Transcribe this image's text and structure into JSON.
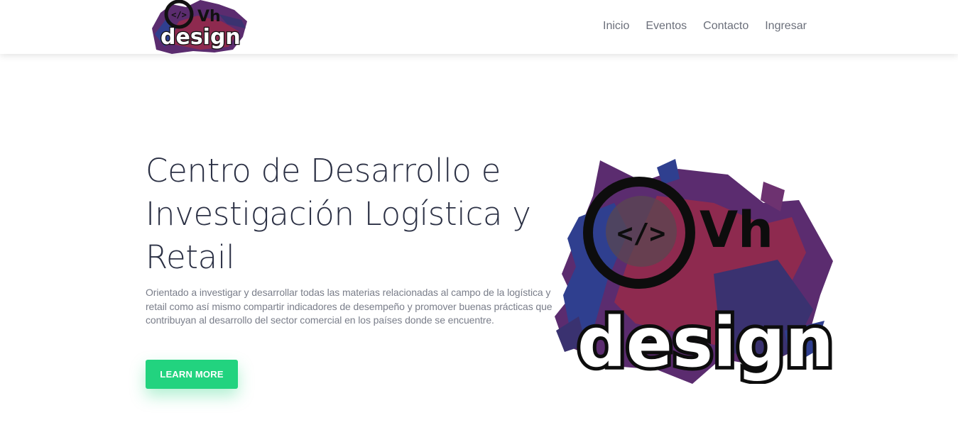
{
  "nav": {
    "logo": {
      "text_lines": [
        "</>",
        "Vh",
        "design"
      ],
      "icon_name": "vh-design-logo"
    },
    "links": [
      "Inicio",
      "Eventos",
      "Contacto",
      "Ingresar"
    ]
  },
  "hero": {
    "title": "Centro de Desarrollo e Investigación Logística y Retail",
    "description": "Orientado a investigar y desarrollar todas las materias relacionadas al campo de la logística y retail como así mismo compartir indicadores de desempeño y promover buenas prácticas que contribuyan al desarrollo del sector comercial en los países donde se encuentre.",
    "cta_label": "LEARN MORE",
    "logo": {
      "text_lines": [
        "</>",
        "Vh",
        "design"
      ],
      "icon_name": "vh-design-logo"
    }
  },
  "colors": {
    "accent": "#22d37f",
    "title": "#2b3044",
    "text": "#7a7e8a",
    "nav_link": "#6b6f7a",
    "splash_purple": "#5b2c6f",
    "splash_crimson": "#8e2a4f",
    "splash_blue": "#2f3f8f"
  }
}
